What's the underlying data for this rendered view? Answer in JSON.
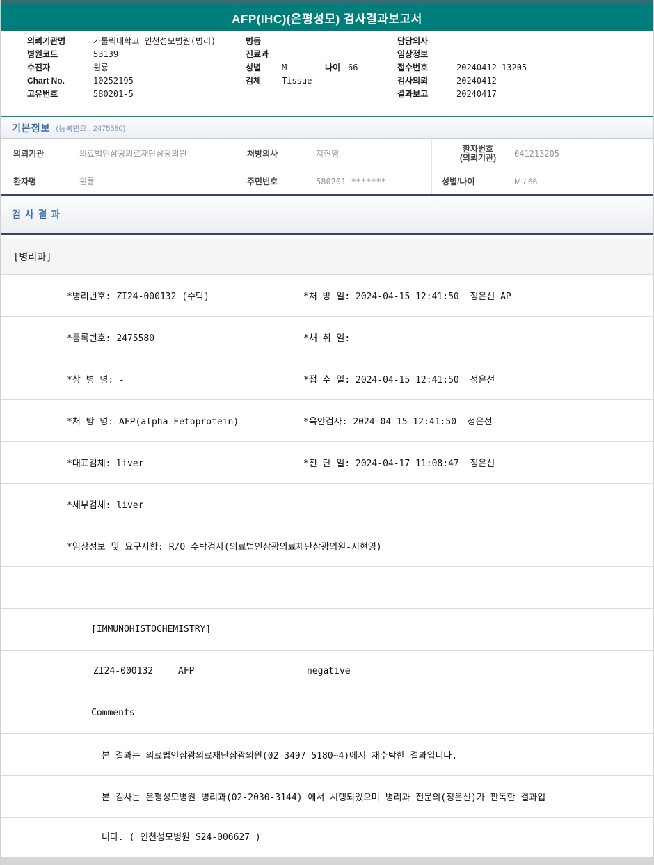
{
  "title": "AFP(IHC)(은평성모) 검사결과보고서",
  "patient_header": {
    "left": [
      {
        "label": "의뢰기관명",
        "value": "가톨릭대학교 인천성모병원(병리)"
      },
      {
        "label": "병원코드",
        "value": "53139"
      },
      {
        "label": "수진자",
        "value": "원룡"
      },
      {
        "label": "Chart No.",
        "value": "10252195"
      },
      {
        "label": "고유번호",
        "value": "580201-5"
      }
    ],
    "middle": [
      {
        "label": "병동",
        "value": ""
      },
      {
        "label": "진료과",
        "value": ""
      },
      {
        "label": "성별",
        "value": "M",
        "label2": "나이",
        "value2": "66"
      },
      {
        "label": "검체",
        "value": "Tissue"
      }
    ],
    "right": [
      {
        "label": "담당의사",
        "value": ""
      },
      {
        "label": "임상정보",
        "value": ""
      },
      {
        "label": "접수번호",
        "value": "20240412-13205"
      },
      {
        "label": "검사의뢰",
        "value": "20240412"
      },
      {
        "label": "결과보고",
        "value": "20240417"
      }
    ]
  },
  "basic_info": {
    "title": "기본정보",
    "subtitle": "(등록번호 : 2475580)",
    "row1": [
      {
        "label": "의뢰기관",
        "value": "의료법인삼광의료재단삼광의원"
      },
      {
        "label": "처방의사",
        "value": "지현영"
      },
      {
        "label": "환자번호",
        "label2": "(의뢰기관)",
        "value": "041213205"
      }
    ],
    "row2": [
      {
        "label": "환자명",
        "value": "원룡"
      },
      {
        "label": "주민번호",
        "value": "580201-*******"
      },
      {
        "label": "성별/나이",
        "value": "M / 66"
      }
    ]
  },
  "results": {
    "title": "검 사 결 과",
    "department": "[병리과]",
    "detail_rows": [
      {
        "left": "*병리번호: ZI24-000132 (수탁)",
        "right": "*처 방 일: 2024-04-15 12:41:50  정은선 AP"
      },
      {
        "left": "*등록번호: 2475580",
        "right": "*채 취 일:"
      },
      {
        "left": "*상 병 명: -",
        "right": "*접 수 일: 2024-04-15 12:41:50  정은선"
      },
      {
        "left": "*처 방 명: AFP(alpha-Fetoprotein)",
        "right": "*육안검사: 2024-04-15 12:41:50  정은선"
      },
      {
        "left": "*대표검체: liver",
        "right": "*진 단 일: 2024-04-17 11:08:47  정은선"
      },
      {
        "left": "*세부검체: liver",
        "right": ""
      },
      {
        "left": "*임상정보 및 요구사항: R/O 수탁검사(의료법인삼광의료재단삼광의원-지현영)",
        "right": ""
      }
    ],
    "ihc_header": "[IMMUNOHISTOCHEMISTRY]",
    "ihc_result": {
      "code": "ZI24-000132",
      "test": "AFP",
      "result": "negative"
    },
    "comments_label": "Comments",
    "comments": [
      "본 결과는 의료법인삼광의료재단삼광의원(02-3497-5180~4)에서 재수탁한 결과입니다.",
      "본 검사는 은평성모병원 병리과(02-2030-3144) 에서 시행되었으며 병리과 전문의(정은선)가 판독한 결과입",
      "니다. ( 인천성모병원 S24-006627 )"
    ]
  }
}
